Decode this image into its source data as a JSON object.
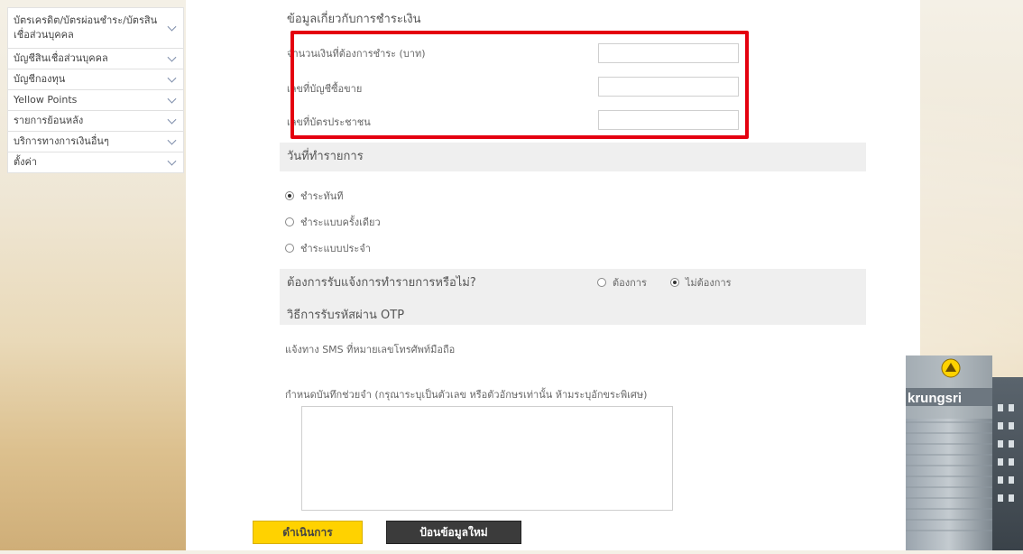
{
  "sidebar": {
    "items": [
      {
        "label": "บัตรเครดิต/บัตรผ่อนชำระ/บัตรสินเชื่อส่วนบุคคล"
      },
      {
        "label": "บัญชีสินเชื่อส่วนบุคคล"
      },
      {
        "label": "บัญชีกองทุน"
      },
      {
        "label": "Yellow Points"
      },
      {
        "label": "รายการย้อนหลัง"
      },
      {
        "label": "บริการทางการเงินอื่นๆ"
      },
      {
        "label": "ตั้งค่า"
      }
    ]
  },
  "payment_info": {
    "title": "ข้อมูลเกี่ยวกับการชำระเงิน",
    "amount_label": "จำนวนเงินที่ต้องการชำระ (บาท)",
    "account_label": "เลขที่บัญชีซื้อขาย",
    "id_card_label": "เลขที่บัตรประชาชน",
    "amount_value": "",
    "account_value": "",
    "id_card_value": ""
  },
  "transaction_date": {
    "title": "วันที่ทำรายการ",
    "options": [
      {
        "label": "ชำระทันที",
        "selected": true
      },
      {
        "label": "ชำระแบบครั้งเดียว",
        "selected": false
      },
      {
        "label": "ชำระแบบประจำ",
        "selected": false
      }
    ]
  },
  "notification": {
    "question": "ต้องการรับแจ้งการทำรายการหรือไม่?",
    "yes_label": "ต้องการ",
    "no_label": "ไม่ต้องการ",
    "selected": "no"
  },
  "otp": {
    "title": "วิธีการรับรหัสผ่าน OTP",
    "note": "แจ้งทาง SMS ที่หมายเลขโทรศัพท์มือถือ"
  },
  "memo": {
    "label": "กำหนดบันทึกช่วยจำ (กรุณาระบุเป็นตัวเลข หรือตัวอักษรเท่านั้น ห้ามระบุอักขระพิเศษ)",
    "value": ""
  },
  "buttons": {
    "submit": "ดำเนินการ",
    "reset": "ป้อนข้อมูลใหม่"
  },
  "branding": {
    "building_sign": "krungsri",
    "accent_color": "#ffd200",
    "highlight_color": "#e4000f"
  }
}
